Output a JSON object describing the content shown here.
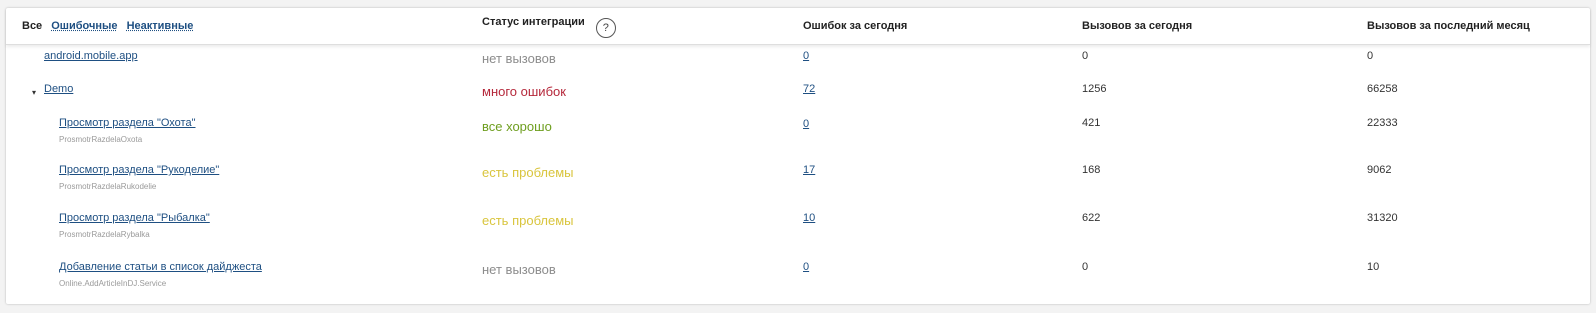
{
  "filters": {
    "all": "Все",
    "errored": "Ошибочные",
    "inactive": "Неактивные"
  },
  "columns": {
    "status": "Статус интеграции",
    "errors_today": "Ошибок за сегодня",
    "calls_today": "Вызовов за сегодня",
    "calls_month": "Вызовов за последний месяц"
  },
  "help_label": "?",
  "toggle_icon": "▾",
  "status_colors": {
    "none": "#8c8c8c",
    "many_errors": "#b5283b",
    "ok": "#6e9e1f",
    "problems": "#d9c53d"
  },
  "rows": [
    {
      "name": "android.mobile.app",
      "code": "",
      "status": "нет вызовов",
      "errors": "0",
      "calls_today": "0",
      "calls_month": "0"
    },
    {
      "name": "Demo",
      "code": "",
      "status": "много ошибок",
      "errors": "72",
      "calls_today": "1256",
      "calls_month": "66258"
    },
    {
      "name": "Просмотр раздела \"Охота\"",
      "code": "ProsmotrRazdelaOxota",
      "status": "все хорошо",
      "errors": "0",
      "calls_today": "421",
      "calls_month": "22333"
    },
    {
      "name": "Просмотр раздела \"Рукоделие\"",
      "code": "ProsmotrRazdelaRukodelie",
      "status": "есть проблемы",
      "errors": "17",
      "calls_today": "168",
      "calls_month": "9062"
    },
    {
      "name": "Просмотр раздела \"Рыбалка\"",
      "code": "ProsmotrRazdelaRybalka",
      "status": "есть проблемы",
      "errors": "10",
      "calls_today": "622",
      "calls_month": "31320"
    },
    {
      "name": "Добавление статьи в список дайджеста",
      "code": "Online.AddArticleInDJ.Service",
      "status": "нет вызовов",
      "errors": "0",
      "calls_today": "0",
      "calls_month": "10"
    }
  ]
}
